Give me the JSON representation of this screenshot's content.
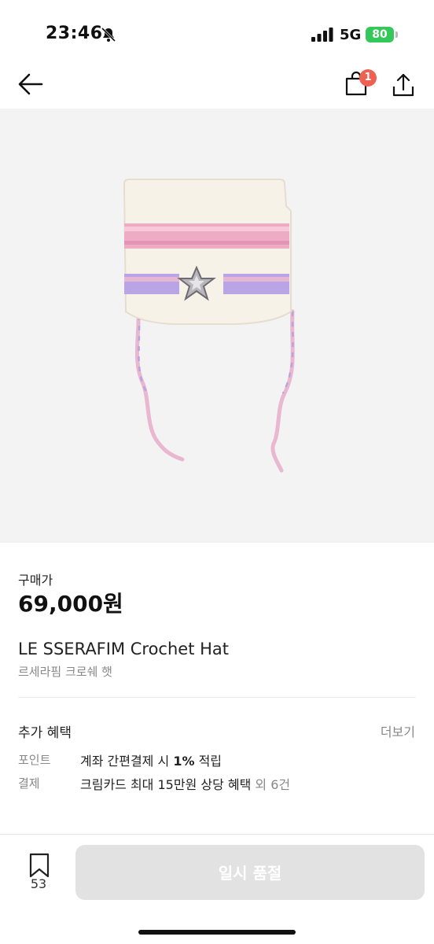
{
  "status_bar": {
    "time": "23:46",
    "network": "5G",
    "battery": "80",
    "icons": [
      "bell-slash-icon",
      "signal-icon",
      "battery-icon"
    ]
  },
  "nav": {
    "back_icon": "arrow-left-icon",
    "shop_icon": "shopping-bag-icon",
    "cart_badge": "1",
    "share_icon": "share-icon"
  },
  "product": {
    "image": "crochet-hat-photo",
    "price_label": "구매가",
    "price": "69,000원",
    "name_en": "LE SSERAFIM Crochet Hat",
    "name_ko": "르세라핌 크로쉐 햇"
  },
  "benefits": {
    "title": "추가 혜택",
    "more_label": "더보기",
    "rows": [
      {
        "label": "포인트",
        "text_before": "계좌 간편결제 시 ",
        "bold": "1%",
        "text_after": " 적립",
        "muted": ""
      },
      {
        "label": "결제",
        "text_before": "크림카드 최대 15만원 상당 혜택",
        "bold": "",
        "text_after": "",
        "muted": " 외 6건"
      }
    ]
  },
  "bottom_bar": {
    "bookmark_icon": "bookmark-icon",
    "bookmark_count": "53",
    "buy_label": "일시 품절"
  },
  "colors": {
    "badge": "#ef6253",
    "battery": "#34c759",
    "disabled_button": "#e2e2e2",
    "image_background": "#f3f3f3"
  }
}
